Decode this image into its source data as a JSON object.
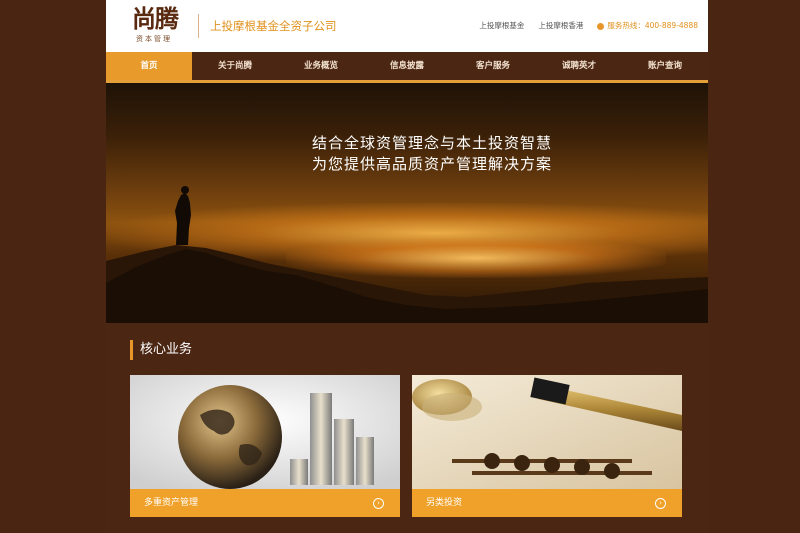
{
  "brand": {
    "logo_main": "尚腾",
    "logo_sub": "资本管理"
  },
  "header": {
    "company": "上投摩根基金全资子公司",
    "links": [
      "上投摩根基金",
      "上投摩根香港"
    ],
    "hotline_label": "服务热线：400-889-4888"
  },
  "nav": {
    "items": [
      "首页",
      "关于尚腾",
      "业务概览",
      "信息披露",
      "客户服务",
      "诚聘英才",
      "账户查询"
    ],
    "active_index": 0
  },
  "banner": {
    "line1": "结合全球资管理念与本土投资智慧",
    "line2": "为您提供高品质资产管理解决方案"
  },
  "section": {
    "title": "核心业务"
  },
  "cards": [
    {
      "label": "多重资产管理",
      "arrow_icon": "circle-arrow-right-icon"
    },
    {
      "label": "另类投资",
      "arrow_icon": "circle-arrow-right-icon"
    }
  ],
  "colors": {
    "accent": "#e8962a",
    "background": "#4b2613",
    "header_bg": "#ffffff",
    "brand_text": "#e0901c"
  }
}
